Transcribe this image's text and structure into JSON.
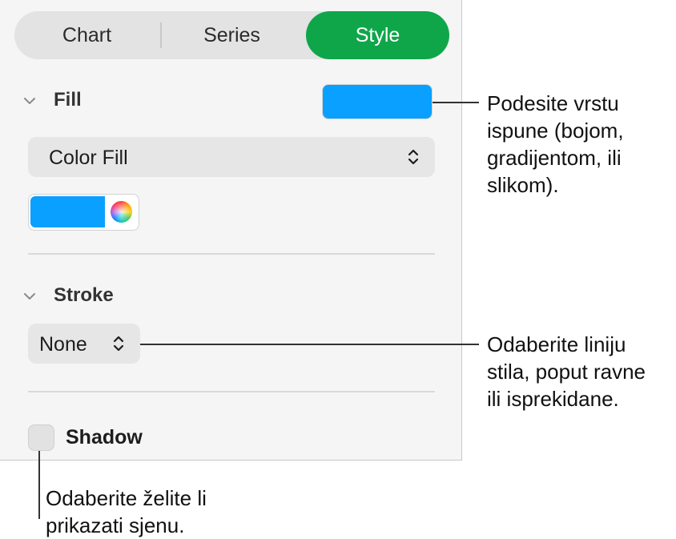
{
  "tabs": {
    "chart": "Chart",
    "series": "Series",
    "style": "Style",
    "active": "Style"
  },
  "fill": {
    "title": "Fill",
    "swatch_color": "#0aa0ff",
    "type_value": "Color Fill",
    "well_color": "#0aa0ff"
  },
  "stroke": {
    "title": "Stroke",
    "value": "None"
  },
  "shadow": {
    "label": "Shadow",
    "checked": false
  },
  "callouts": {
    "fill": [
      "Podesite vrstu",
      "ispune (bojom,",
      "gradijentom, ili",
      "slikom)."
    ],
    "stroke": [
      "Odaberite liniju",
      "stila, poput ravne",
      "ili isprekidane."
    ],
    "shadow": [
      "Odaberite želite li",
      "prikazati sjenu."
    ]
  },
  "icons": {
    "section_chevron": "chevron-down-icon",
    "popup_arrows": "updown-arrows-icon",
    "color_wheel": "color-wheel-icon"
  },
  "colors": {
    "accent": "#0fa64a",
    "fill": "#0aa0ff"
  }
}
